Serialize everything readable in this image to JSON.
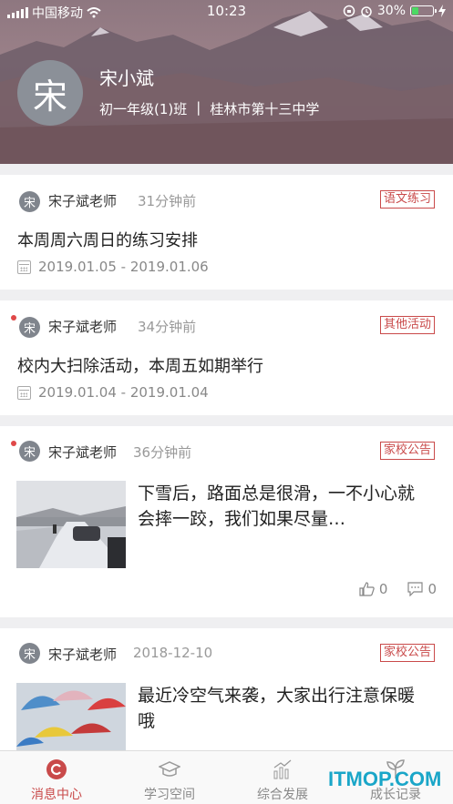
{
  "status_bar": {
    "carrier": "中国移动",
    "time": "10:23",
    "battery": "30%",
    "battery_level": 0.3
  },
  "profile": {
    "avatar_char": "宋",
    "name": "宋小斌",
    "class": "初一年级(1)班",
    "separator": "|",
    "school": "桂林市第十三中学"
  },
  "messages": [
    {
      "avatar_char": "宋",
      "sender": "宋子斌老师",
      "time": "31分钟前",
      "tag": "语文练习",
      "title": "本周周六周日的练习安排",
      "date": "2019.01.05 - 2019.01.06",
      "unread": false
    },
    {
      "avatar_char": "宋",
      "sender": "宋子斌老师",
      "time": "34分钟前",
      "tag": "其他活动",
      "title": "校内大扫除活动，本周五如期举行",
      "date": "2019.01.04 - 2019.01.04",
      "unread": true
    },
    {
      "avatar_char": "宋",
      "sender": "宋子斌老师",
      "time": "36分钟前",
      "tag": "家校公告",
      "text": "下雪后，路面总是很滑，一不小心就会摔一跤，我们如果尽量…",
      "likes": "0",
      "comments": "0",
      "unread": true
    },
    {
      "avatar_char": "宋",
      "sender": "宋子斌老师",
      "time": "2018-12-10",
      "tag": "家校公告",
      "text": "最近冷空气来袭，大家出行注意保暖哦",
      "unread": false
    }
  ],
  "tabs": [
    {
      "label": "消息中心",
      "icon": "message-center-icon",
      "active": true
    },
    {
      "label": "学习空间",
      "icon": "graduation-cap-icon",
      "active": false
    },
    {
      "label": "综合发展",
      "icon": "bar-chart-icon",
      "active": false
    },
    {
      "label": "成长记录",
      "icon": "sprout-icon",
      "active": false
    }
  ],
  "watermark": "ITMOP.COM",
  "colors": {
    "accent": "#c94a4a",
    "unread_dot": "#e04848",
    "watermark": "#1aa6c8"
  }
}
